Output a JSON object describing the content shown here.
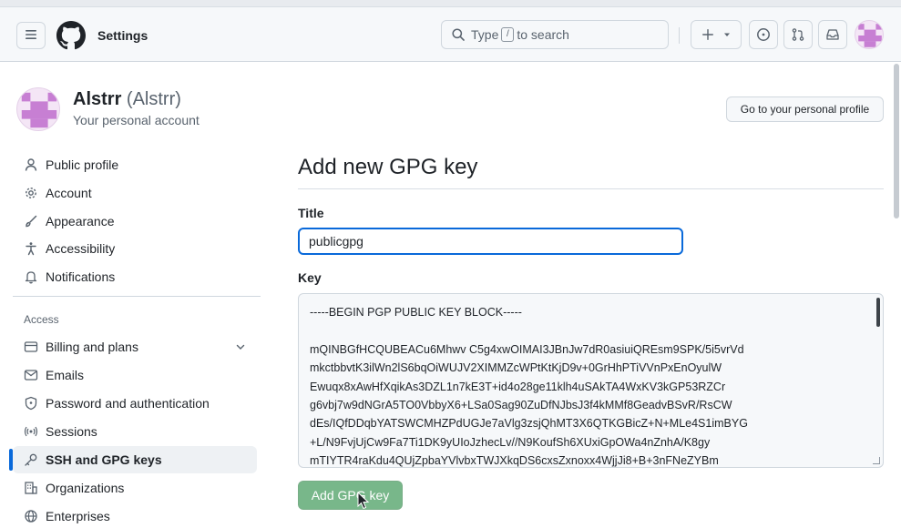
{
  "header": {
    "title": "Settings",
    "search_prefix": "Type",
    "search_kbd": "/",
    "search_suffix": "to search"
  },
  "profile": {
    "display_name": "Alstrr",
    "login": "(Alstrr)",
    "subtitle": "Your personal account",
    "goto_button": "Go to your personal profile"
  },
  "sidebar": {
    "items": [
      {
        "label": "Public profile",
        "icon": "person-icon"
      },
      {
        "label": "Account",
        "icon": "gear-icon"
      },
      {
        "label": "Appearance",
        "icon": "paintbrush-icon"
      },
      {
        "label": "Accessibility",
        "icon": "accessibility-icon"
      },
      {
        "label": "Notifications",
        "icon": "bell-icon"
      }
    ],
    "access_heading": "Access",
    "access_items": [
      {
        "label": "Billing and plans",
        "icon": "credit-card-icon"
      },
      {
        "label": "Emails",
        "icon": "mail-icon"
      },
      {
        "label": "Password and authentication",
        "icon": "shield-lock-icon"
      },
      {
        "label": "Sessions",
        "icon": "broadcast-icon"
      },
      {
        "label": "SSH and GPG keys",
        "icon": "key-icon",
        "active": true
      },
      {
        "label": "Organizations",
        "icon": "organization-icon"
      },
      {
        "label": "Enterprises",
        "icon": "globe-icon"
      }
    ]
  },
  "main": {
    "title": "Add new GPG key",
    "title_label": "Title",
    "title_value": "publicgpg",
    "key_label": "Key",
    "key_lines": [
      "-----BEGIN PGP PUBLIC KEY BLOCK-----",
      "",
      "mQINBGfHCQUBEACu6Mhwv C5g4xwOIMAI3JBnJw7dR0asiuiQREsm9SPK/5i5vrVd",
      "mkctbbvtK3ilWn2lS6bqOiWUJV2XIMMZcWPtKtKjD9v+0GrHhPTiVVnPxEnOyulW",
      "Ewuqx8xAwHfXqikAs3DZL1n7kE3T+id4o28ge11klh4uSAkTA4WxKV3kGP53RZCr",
      "g6vbj7w9dNGrA5TO0VbbyX6+LSa0Sag90ZuDfNJbsJ3f4kMMf8GeadvBSvR/RsCW",
      "dEs/IQfDDqbYATSWCMHZPdUGJe7aVlg3zsjQhMT3X6QTKGBicZ+N+MLe4S1imBYG",
      "+L/N9FvjUjCw9Fa7Ti1DK9yUIoJzhecLv//N9KoufSh6XUxiGpOWa4nZnhA/K8gy",
      "mTIYTR4raKdu4QUjZpbaYVlvbxTWJXkqDS6cxsZxnoxx4WjjJi8+B+3nFNeZYBm"
    ],
    "submit_button": "Add GPG key"
  }
}
